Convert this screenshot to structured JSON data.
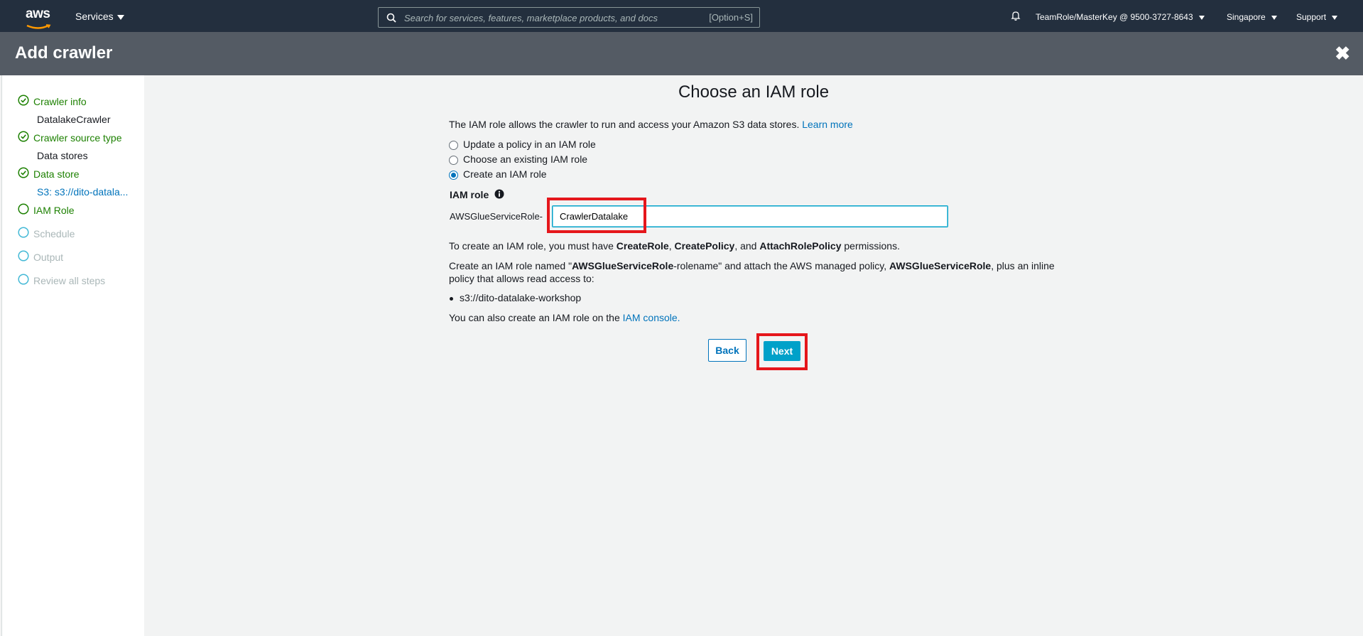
{
  "topnav": {
    "logo_text": "aws",
    "services_label": "Services",
    "search_placeholder": "Search for services, features, marketplace products, and docs",
    "search_shortcut": "[Option+S]",
    "account": "TeamRole/MasterKey @ 9500-3727-8643",
    "region": "Singapore",
    "support": "Support"
  },
  "titlebar": {
    "title": "Add crawler",
    "close_glyph": "✖"
  },
  "sidebar": {
    "steps": [
      {
        "label": "Crawler info",
        "state": "done",
        "sub": "DatalakeCrawler"
      },
      {
        "label": "Crawler source type",
        "state": "done",
        "sub": "Data stores"
      },
      {
        "label": "Data store",
        "state": "done",
        "sub": "S3: s3://dito-datala..."
      },
      {
        "label": "IAM Role",
        "state": "active"
      },
      {
        "label": "Schedule",
        "state": "pending"
      },
      {
        "label": "Output",
        "state": "pending"
      },
      {
        "label": "Review all steps",
        "state": "pending"
      }
    ]
  },
  "main": {
    "heading": "Choose an IAM role",
    "description": "The IAM role allows the crawler to run and access your Amazon S3 data stores.",
    "learn_more": "Learn more",
    "options": [
      {
        "label": "Update a policy in an IAM role",
        "selected": false
      },
      {
        "label": "Choose an existing IAM role",
        "selected": false
      },
      {
        "label": "Create an IAM role",
        "selected": true
      }
    ],
    "iam_role_label": "IAM role",
    "role_prefix": "AWSGlueServiceRole-",
    "role_value": "CrawlerDatalake",
    "perm": {
      "p1": "To create an IAM role, you must have ",
      "b1": "CreateRole",
      "s1": ", ",
      "b2": "CreatePolicy",
      "s2": ", and ",
      "b3": "AttachRolePolicy",
      "p2": " permissions."
    },
    "create_desc": {
      "p1": "Create an IAM role named \"",
      "b1": "AWSGlueServiceRole",
      "p2": "-rolename\" and attach the AWS managed policy, ",
      "b2": "AWSGlueServiceRole",
      "p3": ", plus an inline policy that allows read access to:"
    },
    "bucket": "s3://dito-datalake-workshop",
    "console_text": "You can also create an IAM role on the ",
    "console_link": "IAM console.",
    "back_label": "Back",
    "next_label": "Next"
  },
  "colors": {
    "nav_bg": "#232f3e",
    "title_bg": "#545b64",
    "accent": "#00a1c9",
    "link": "#0073bb",
    "success": "#1d8102",
    "highlight": "#e5161b"
  }
}
